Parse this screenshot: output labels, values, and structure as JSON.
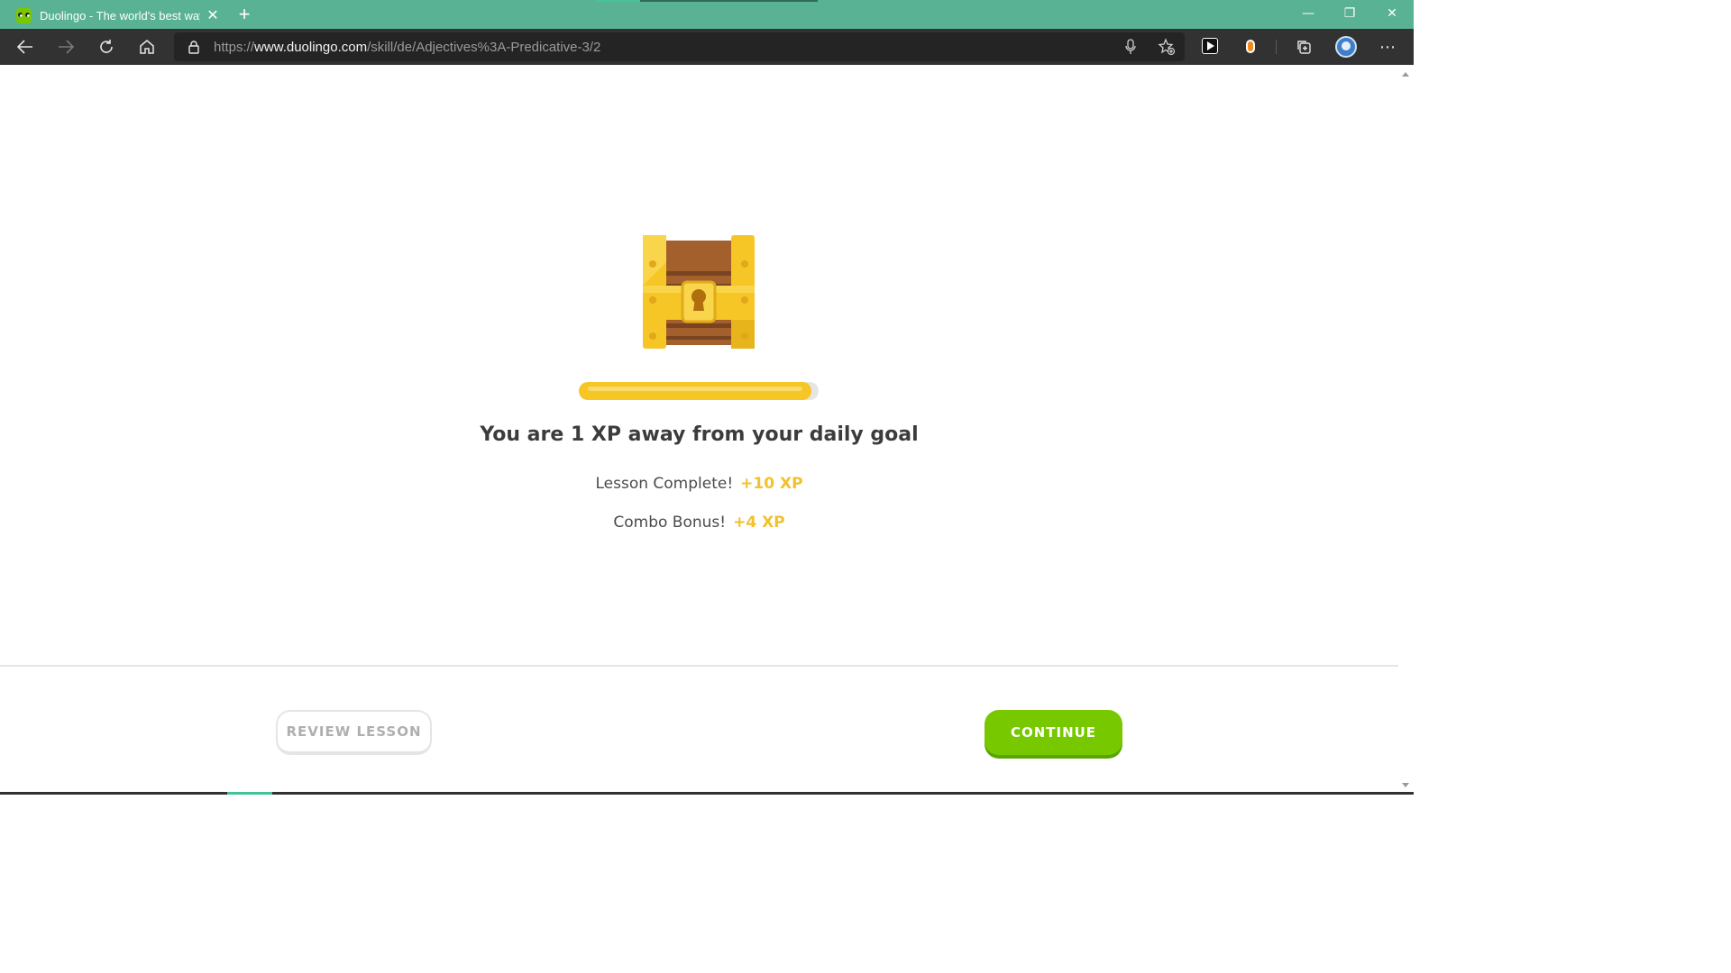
{
  "browser": {
    "tab_title": "Duolingo - The world's best way to learn a language",
    "tab_close": "✕",
    "new_tab": "+",
    "url_scheme": "https://",
    "url_host": "www.duolingo.com",
    "url_path": "/skill/de/Adjectives%3A-Predicative-3/2",
    "window_controls": {
      "minimize": "—",
      "restore": "❐",
      "close": "✕"
    },
    "more": "⋯"
  },
  "lesson_end": {
    "daily_goal_progress": 0.97,
    "headline": "You are 1 XP away from your daily goal",
    "rewards": [
      {
        "label": "Lesson Complete!",
        "amount": "+10 XP"
      },
      {
        "label": "Combo Bonus!",
        "amount": "+4 XP"
      }
    ]
  },
  "footer": {
    "review_label": "REVIEW LESSON",
    "continue_label": "CONTINUE"
  },
  "colors": {
    "titlebar": "#5ab294",
    "xp_gold": "#f2c12e",
    "continue_green": "#78c800"
  },
  "icons": {
    "back": "back-arrow-icon",
    "forward": "forward-arrow-icon",
    "reload": "reload-icon",
    "home": "home-icon",
    "lock": "lock-icon",
    "mic": "microphone-icon",
    "favorites": "add-favorite-icon",
    "collections": "collections-icon",
    "chest": "treasure-chest-icon"
  }
}
